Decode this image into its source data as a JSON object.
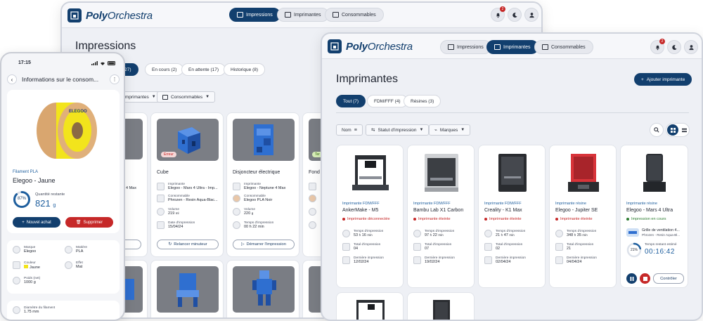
{
  "brand": {
    "name_bold": "Poly",
    "name_light": "Orchestra"
  },
  "back_window": {
    "nav": [
      {
        "label": "Impressions",
        "active": true
      },
      {
        "label": "Imprimantes",
        "active": false
      },
      {
        "label": "Consommables",
        "active": false
      }
    ],
    "notif_count": "2",
    "title": "Impressions",
    "tabs": [
      {
        "label": "Toutes (27)",
        "visible": "(27)"
      },
      {
        "label": "En cours (2)"
      },
      {
        "label": "En attente (17)"
      },
      {
        "label": "Historique (8)"
      }
    ],
    "filters": [
      "Imprimantes",
      "Consommables"
    ],
    "cards": [
      {
        "name": "",
        "line": "4 Max"
      },
      {
        "name": "Cube",
        "tag": "Erreur",
        "printer_label": "Imprimante",
        "printer": "Elegoo - Mars 4 Ultra - Imp...",
        "material_label": "Consommable",
        "material": "Phrozen - Resin Aqua-Blac...",
        "volume_label": "Volume",
        "volume": "219",
        "volume_unit": "ml",
        "date_label": "Date d'impression",
        "date": "15/04/24",
        "action": "Relancer minuteur"
      },
      {
        "name": "Disjoncteur électrique",
        "printer_label": "Imprimante",
        "printer": "Elegoo - Neptune 4 Max",
        "material_label": "Consommable",
        "material": "Elegoo PLA Noir",
        "volume_label": "Volume",
        "volume": "220",
        "volume_unit": "g",
        "date_label": "Temps d'impression",
        "date": "00 h 22 min",
        "action": "Démarrer l'impression"
      },
      {
        "name": "Fond l",
        "tag": "Ter"
      }
    ],
    "left_card_action": "ssion"
  },
  "phone": {
    "time": "17:15",
    "header": "Informations sur le consom...",
    "type": "Filament PLA",
    "name": "Elegoo - Jaune",
    "spool_label": "ELEGOO",
    "qty_label": "Quantité restante",
    "qty_percent": "87%",
    "qty_value": "821",
    "qty_unit": "g",
    "btn_new": "Nouvel achat",
    "btn_delete": "Supprimer",
    "props": [
      {
        "label": "Marque",
        "value": "Elegoo"
      },
      {
        "label": "Matière",
        "value": "PLA"
      },
      {
        "label": "Couleur",
        "value": "Jaune"
      },
      {
        "label": "Effet",
        "value": "Mat"
      },
      {
        "label": "Poids (net)",
        "value": "1000 g"
      }
    ],
    "diameter_label": "Diamètre du filament",
    "diameter_value": "1.75 mm"
  },
  "front_window": {
    "nav": [
      {
        "label": "Impressions",
        "active": false
      },
      {
        "label": "Imprimantes",
        "active": true
      },
      {
        "label": "Consommables",
        "active": false
      }
    ],
    "notif_count": "2",
    "title": "Imprimantes",
    "add_button": "Ajouter imprimante",
    "tabs": [
      "Tout (7)",
      "FDM/FFF (4)",
      "Résines (3)"
    ],
    "filters": [
      "Nom",
      "Statut d'impression",
      "Marques"
    ],
    "printers": [
      {
        "type": "Imprimante FDM/FFF",
        "name": "AnkerMake - M5",
        "status": "Imprimante déconnectée",
        "ok": false,
        "time_label": "Temps d'impression",
        "time_h": "53",
        "time_m": "16",
        "total_label": "Total d'impression",
        "total": "04",
        "last_label": "Dernière impression",
        "last": "12/02/24"
      },
      {
        "type": "Imprimante FDM/FFF",
        "name": "Bambu Lab X1 Carbon",
        "status": "Imprimante éteinte",
        "ok": false,
        "time_label": "Temps d'impression",
        "time_h": "97",
        "time_m": "22",
        "total_label": "Total d'impression",
        "total": "07",
        "last_label": "Dernière impression",
        "last": "19/02/24"
      },
      {
        "type": "Imprimante FDM/FFF",
        "name": "Creality - K1 Max",
        "status": "Imprimante éteinte",
        "ok": false,
        "time_label": "Temps d'impression",
        "time_h": "21",
        "time_m": "47",
        "total_label": "Total d'impression",
        "total": "02",
        "last_label": "Dernière impression",
        "last": "02/04/24"
      },
      {
        "type": "Imprimante résine",
        "name": "Elegoo - Jupiter SE",
        "status": "Imprimante éteinte",
        "ok": false,
        "time_label": "Temps d'impression",
        "time_h": "348",
        "time_m": "35",
        "total_label": "Total d'impression",
        "total": "21",
        "last_label": "Dernière impression",
        "last": "04/04/24"
      },
      {
        "type": "Imprimante résine",
        "name": "Elegoo - Mars 4 Ultra",
        "status": "Impression en cours",
        "ok": true,
        "job": "Grille de ventilation 4...",
        "job_material": "Phrozen - Resin Aqua-Bl...",
        "progress_percent": "21%",
        "progress": 0.21,
        "remaining_label": "Temps restant estimé",
        "remaining": "00:16:42",
        "control": "Contrôler"
      }
    ],
    "unit_h": "h",
    "unit_min": "min"
  },
  "colors": {
    "primary": "#123f6e",
    "danger": "#c62828",
    "success": "#2e7d32",
    "link": "#1f5f9e",
    "spool": "#f2e41c"
  }
}
